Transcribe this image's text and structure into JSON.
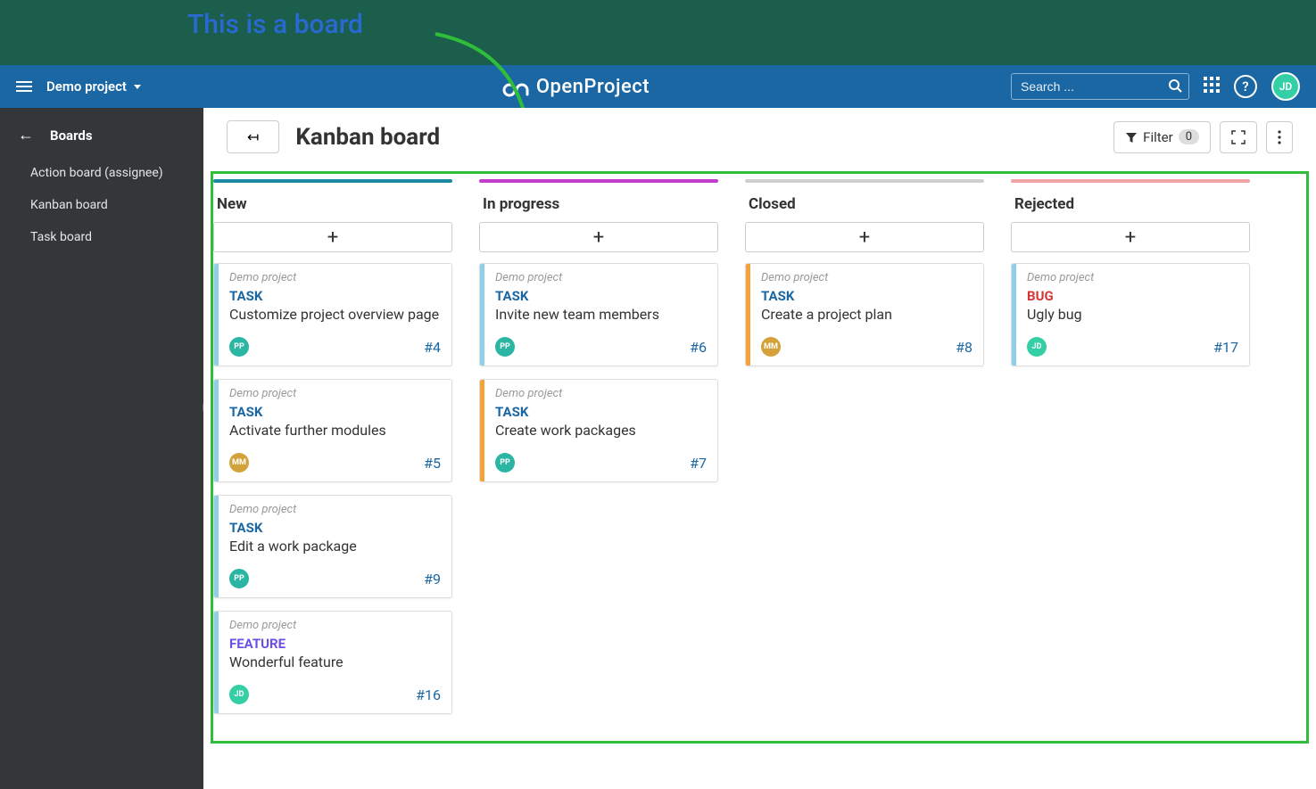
{
  "banner": {
    "annotation": "This is a board"
  },
  "topbar": {
    "project": "Demo project",
    "brand": "OpenProject",
    "search_placeholder": "Search ...",
    "avatar": "JD"
  },
  "sidebar": {
    "title": "Boards",
    "items": [
      "Action board (assignee)",
      "Kanban board",
      "Task board"
    ]
  },
  "main": {
    "title": "Kanban board",
    "filter_label": "Filter",
    "filter_count": "0"
  },
  "columns": [
    {
      "name": "New",
      "color": "#1a8aa3",
      "cards": [
        {
          "project": "Demo project",
          "type": "TASK",
          "typeClass": "type-task",
          "title": "Customize project overview page",
          "avatar": "PP",
          "avClass": "av-pp",
          "id": "#4",
          "stripe": "#8fd0e8"
        },
        {
          "project": "Demo project",
          "type": "TASK",
          "typeClass": "type-task",
          "title": "Activate further modules",
          "avatar": "MM",
          "avClass": "av-mm",
          "id": "#5",
          "stripe": "#8fd0e8"
        },
        {
          "project": "Demo project",
          "type": "TASK",
          "typeClass": "type-task",
          "title": "Edit a work package",
          "avatar": "PP",
          "avClass": "av-pp",
          "id": "#9",
          "stripe": "#8fd0e8"
        },
        {
          "project": "Demo project",
          "type": "FEATURE",
          "typeClass": "type-feature",
          "title": "Wonderful feature",
          "avatar": "JD",
          "avClass": "av-jd",
          "id": "#16",
          "stripe": "#8fd0e8"
        }
      ]
    },
    {
      "name": "In progress",
      "color": "#c23dcc",
      "cards": [
        {
          "project": "Demo project",
          "type": "TASK",
          "typeClass": "type-task",
          "title": "Invite new team members",
          "avatar": "PP",
          "avClass": "av-pp",
          "id": "#6",
          "stripe": "#8fd0e8"
        },
        {
          "project": "Demo project",
          "type": "TASK",
          "typeClass": "type-task",
          "title": "Create work packages",
          "avatar": "PP",
          "avClass": "av-pp",
          "id": "#7",
          "stripe": "#f2a33a"
        }
      ]
    },
    {
      "name": "Closed",
      "color": "#cfcfcf",
      "cards": [
        {
          "project": "Demo project",
          "type": "TASK",
          "typeClass": "type-task",
          "title": "Create a project plan",
          "avatar": "MM",
          "avClass": "av-mm",
          "id": "#8",
          "stripe": "#f2a33a"
        }
      ]
    },
    {
      "name": "Rejected",
      "color": "#f2a3a3",
      "cards": [
        {
          "project": "Demo project",
          "type": "BUG",
          "typeClass": "type-bug",
          "title": "Ugly bug",
          "avatar": "JD",
          "avClass": "av-jd",
          "id": "#17",
          "stripe": "#8fd0e8"
        }
      ]
    }
  ]
}
